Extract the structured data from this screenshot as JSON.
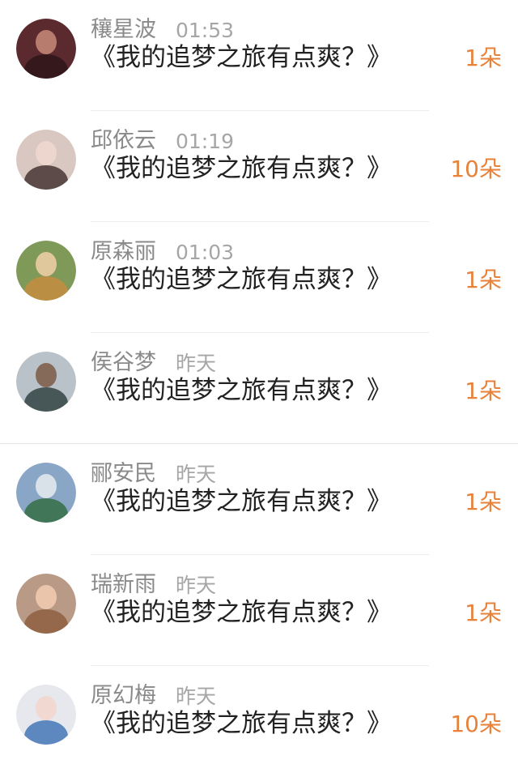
{
  "messages": [
    {
      "name": "穰星波",
      "time": "01:53",
      "title": "《我的追梦之旅有点爽？》",
      "count": "1朵",
      "avatar_icon": "avatar-icon",
      "avatar_colors": [
        "#5a2a2e",
        "#c98b7a",
        "#2b1416"
      ]
    },
    {
      "name": "邱依云",
      "time": "01:19",
      "title": "《我的追梦之旅有点爽？》",
      "count": "10朵",
      "avatar_icon": "avatar-icon",
      "avatar_colors": [
        "#d9c7c1",
        "#f0d8cf",
        "#3c2c2a"
      ]
    },
    {
      "name": "原森丽",
      "time": "01:03",
      "title": "《我的追梦之旅有点爽？》",
      "count": "1朵",
      "avatar_icon": "avatar-icon",
      "avatar_colors": [
        "#7f9a58",
        "#f1cfa8",
        "#c98c3f"
      ]
    },
    {
      "name": "侯谷梦",
      "time": "昨天",
      "title": "《我的追梦之旅有点爽？》",
      "count": "1朵",
      "avatar_icon": "avatar-icon",
      "avatar_colors": [
        "#b9c2c8",
        "#7b5a46",
        "#2b3b3a"
      ]
    },
    {
      "name": "郦安民",
      "time": "昨天",
      "title": "《我的追梦之旅有点爽？》",
      "count": "1朵",
      "avatar_icon": "avatar-icon",
      "avatar_colors": [
        "#8aa6c6",
        "#e7ecee",
        "#2e6b3c"
      ]
    },
    {
      "name": "瑞新雨",
      "time": "昨天",
      "title": "《我的追梦之旅有点爽？》",
      "count": "1朵",
      "avatar_icon": "avatar-icon",
      "avatar_colors": [
        "#b99a86",
        "#f3cdb2",
        "#8c5b3c"
      ]
    },
    {
      "name": "原幻梅",
      "time": "昨天",
      "title": "《我的追梦之旅有点爽？》",
      "count": "10朵",
      "avatar_icon": "avatar-icon",
      "avatar_colors": [
        "#e6e8ee",
        "#f2d6cc",
        "#3b6fb3"
      ]
    }
  ]
}
